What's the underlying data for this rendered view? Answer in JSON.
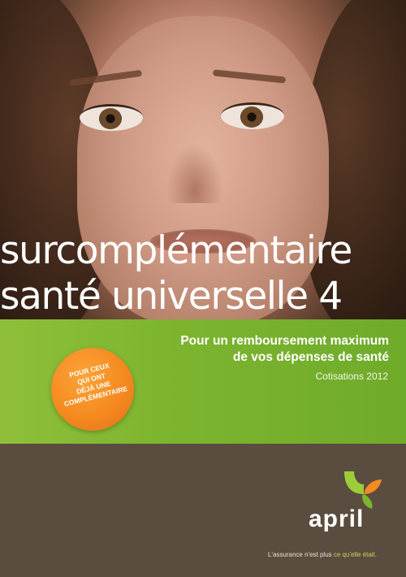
{
  "title": {
    "line1": "surcomplémentaire",
    "line2": "santé universelle 4"
  },
  "subtitle": {
    "line1": "Pour un remboursement maximum",
    "line2": "de vos dépenses de santé"
  },
  "year_text": "Cotisations 2012",
  "badge": {
    "lines": [
      "POUR CEUX",
      "QUI ONT",
      "DÉJÀ UNE",
      "COMPLÉMENTAIRE"
    ]
  },
  "brand": {
    "logo_text": "april",
    "tagline_prefix": "L'assurance n'est plus ",
    "tagline_highlight": "ce qu'elle était."
  },
  "colors": {
    "green": "#7db52f",
    "orange": "#f58a1f",
    "brown": "#5a4c3e",
    "accent_highlight": "#c9d65a"
  },
  "icons": {
    "logo_mark": "april-leaf-logo-icon"
  }
}
